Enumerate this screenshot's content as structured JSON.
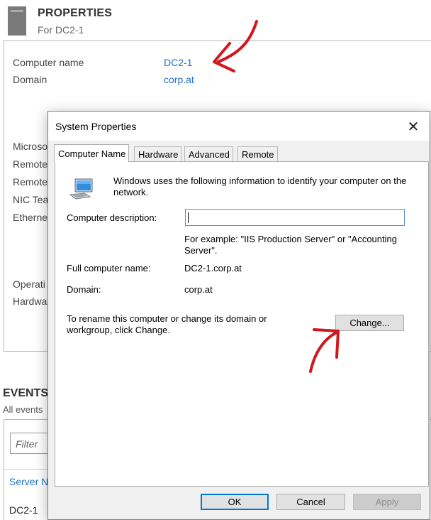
{
  "properties": {
    "title": "PROPERTIES",
    "subtitle": "For DC2-1",
    "computer_name_label": "Computer name",
    "computer_name_value": "DC2-1",
    "domain_label": "Domain",
    "domain_value": "corp.at",
    "partial_labels": [
      "Microso",
      "Remote",
      "Remote",
      "NIC Tea",
      "Etherne",
      "Operati",
      "Hardwa"
    ]
  },
  "events": {
    "title": "EVENTS",
    "subtitle": "All events",
    "filter_placeholder": "Filter",
    "column_server": "Server N",
    "row_server": "DC2-1"
  },
  "dialog": {
    "title": "System Properties",
    "close_glyph": "✕",
    "tabs": [
      "Computer Name",
      "Hardware",
      "Advanced",
      "Remote"
    ],
    "intro": "Windows uses the following information to identify your computer on the network.",
    "description_label": "Computer description:",
    "description_value": "",
    "example_text": "For example: \"IIS Production Server\" or \"Accounting Server\".",
    "full_name_label": "Full computer name:",
    "full_name_value": "DC2-1.corp.at",
    "domain_label": "Domain:",
    "domain_value": "corp.at",
    "rename_text": "To rename this computer or change its domain or workgroup, click Change.",
    "change_button": "Change...",
    "ok_button": "OK",
    "cancel_button": "Cancel",
    "apply_button": "Apply"
  },
  "colors": {
    "link": "#1e72c7",
    "annotation": "#d0171f",
    "dialog_bg": "#f0f0f0",
    "focus_border": "#0078d7"
  },
  "icons": [
    "server-icon",
    "computer-icon",
    "close-icon",
    "annotation-arrow"
  ]
}
